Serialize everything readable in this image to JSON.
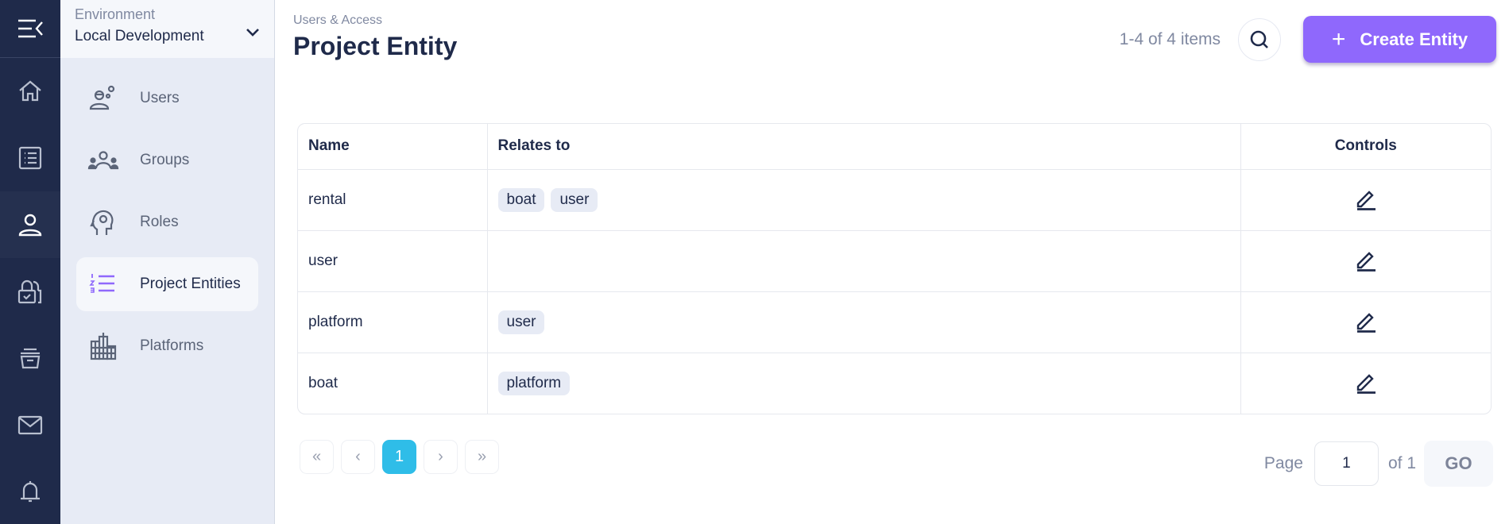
{
  "rail": {
    "toggle_icon": "menu-collapse-icon",
    "items": [
      {
        "icon": "home-icon",
        "active": false
      },
      {
        "icon": "list-icon",
        "active": false
      },
      {
        "icon": "user-icon",
        "active": true
      },
      {
        "icon": "locks-icon",
        "active": false
      },
      {
        "icon": "archive-icon",
        "active": false
      },
      {
        "icon": "mail-icon",
        "active": false
      },
      {
        "icon": "bell-icon",
        "active": false
      }
    ]
  },
  "environment": {
    "label": "Environment",
    "value": "Local Development"
  },
  "subnav": {
    "items": [
      {
        "label": "Users",
        "icon": "users-gear-icon",
        "active": false
      },
      {
        "label": "Groups",
        "icon": "groups-icon",
        "active": false
      },
      {
        "label": "Roles",
        "icon": "roles-head-gear-icon",
        "active": false
      },
      {
        "label": "Project Entities",
        "icon": "numbered-list-icon",
        "active": true
      },
      {
        "label": "Platforms",
        "icon": "buildings-icon",
        "active": false
      }
    ]
  },
  "header": {
    "breadcrumb": "Users & Access",
    "title": "Project Entity",
    "count": "1-4 of 4 items",
    "create_label": "Create Entity"
  },
  "table": {
    "columns": [
      "Name",
      "Relates to",
      "Controls"
    ],
    "rows": [
      {
        "name": "rental",
        "relates_to": [
          "boat",
          "user"
        ]
      },
      {
        "name": "user",
        "relates_to": []
      },
      {
        "name": "platform",
        "relates_to": [
          "user"
        ]
      },
      {
        "name": "boat",
        "relates_to": [
          "platform"
        ]
      }
    ]
  },
  "pagination": {
    "first": "«",
    "prev": "‹",
    "current": "1",
    "next": "›",
    "last": "»",
    "page_label": "Page",
    "page_value": "1",
    "of_label": "of 1",
    "go_label": "GO"
  },
  "colors": {
    "rail_bg": "#1f2a4a",
    "accent": "#8f68fc",
    "active_page": "#2fbde8"
  }
}
